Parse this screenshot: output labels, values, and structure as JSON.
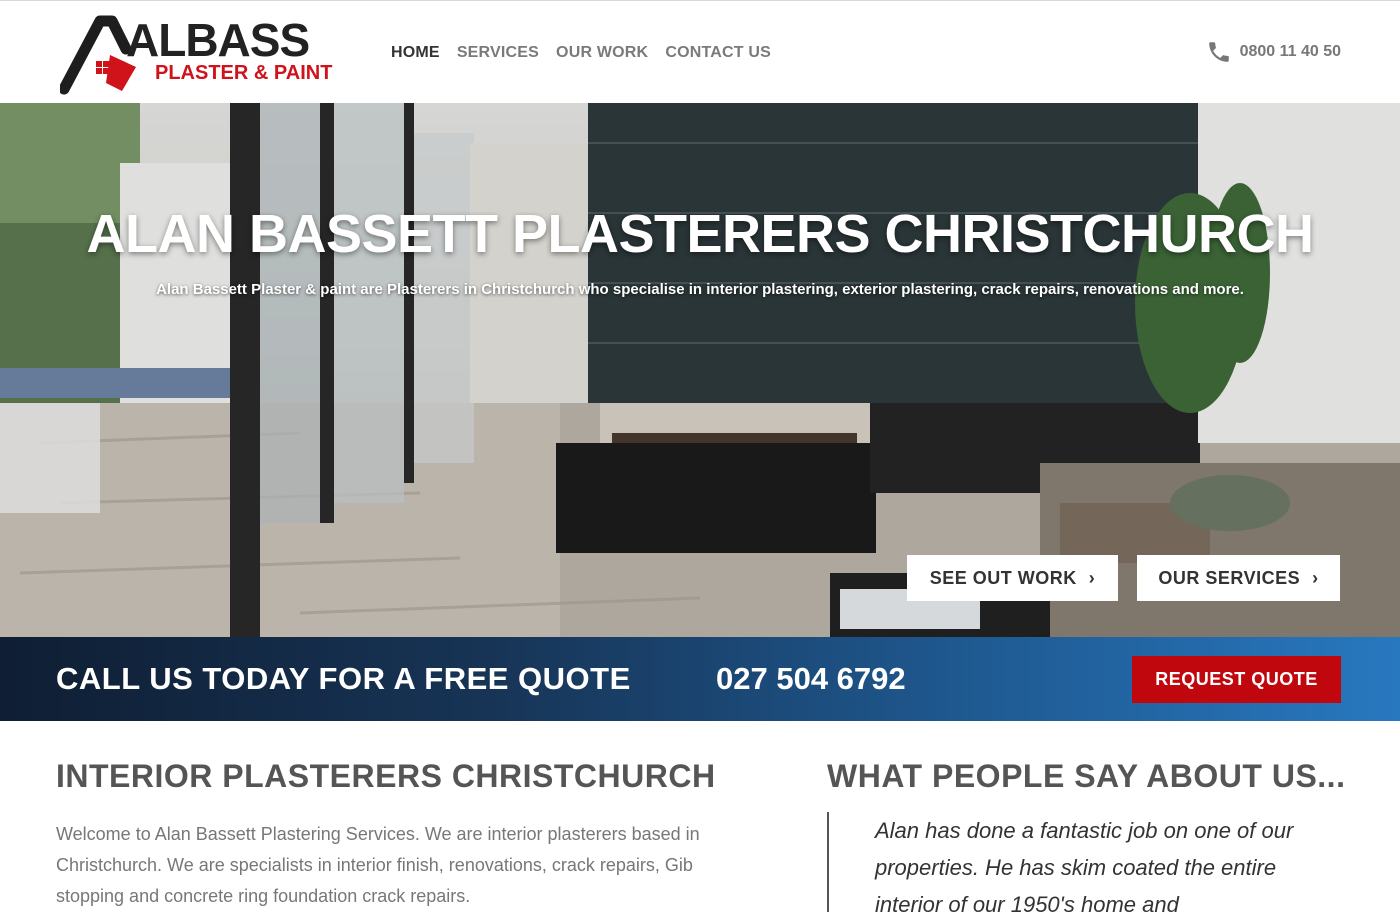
{
  "brand": {
    "name": "ALBASS",
    "tagline": "PLASTER & PAINT",
    "accent": "#d0121a"
  },
  "nav": {
    "items": [
      {
        "label": "HOME",
        "active": true
      },
      {
        "label": "SERVICES",
        "active": false
      },
      {
        "label": "OUR WORK",
        "active": false
      },
      {
        "label": "CONTACT US",
        "active": false
      }
    ]
  },
  "header_phone": {
    "icon": "phone-icon",
    "number": "0800 11 40 50"
  },
  "hero": {
    "title": "ALAN BASSETT PLASTERERS CHRISTCHURCH",
    "subtitle": "Alan Bassett Plaster & paint are Plasterers in Christchurch who specialise in interior plastering, exterior plastering, crack repairs, renovations and more.",
    "buttons": [
      {
        "label": "SEE OUT WORK"
      },
      {
        "label": "OUR SERVICES"
      }
    ]
  },
  "callband": {
    "text": "CALL US TODAY FOR A FREE QUOTE",
    "phone": "027 504 6792",
    "button": "REQUEST QUOTE",
    "button_color": "#c0070d"
  },
  "intro": {
    "heading": "INTERIOR PLASTERERS CHRISTCHURCH",
    "body": "Welcome to Alan Bassett Plastering Services. We are interior plasterers based in Christchurch. We are specialists in interior finish, renovations, crack repairs, Gib stopping and concrete ring foundation crack repairs."
  },
  "testimonials": {
    "heading": "WHAT PEOPLE SAY ABOUT US...",
    "quote": "Alan has done a fantastic job on one of our properties. He has skim coated the entire interior of our 1950's home and"
  }
}
